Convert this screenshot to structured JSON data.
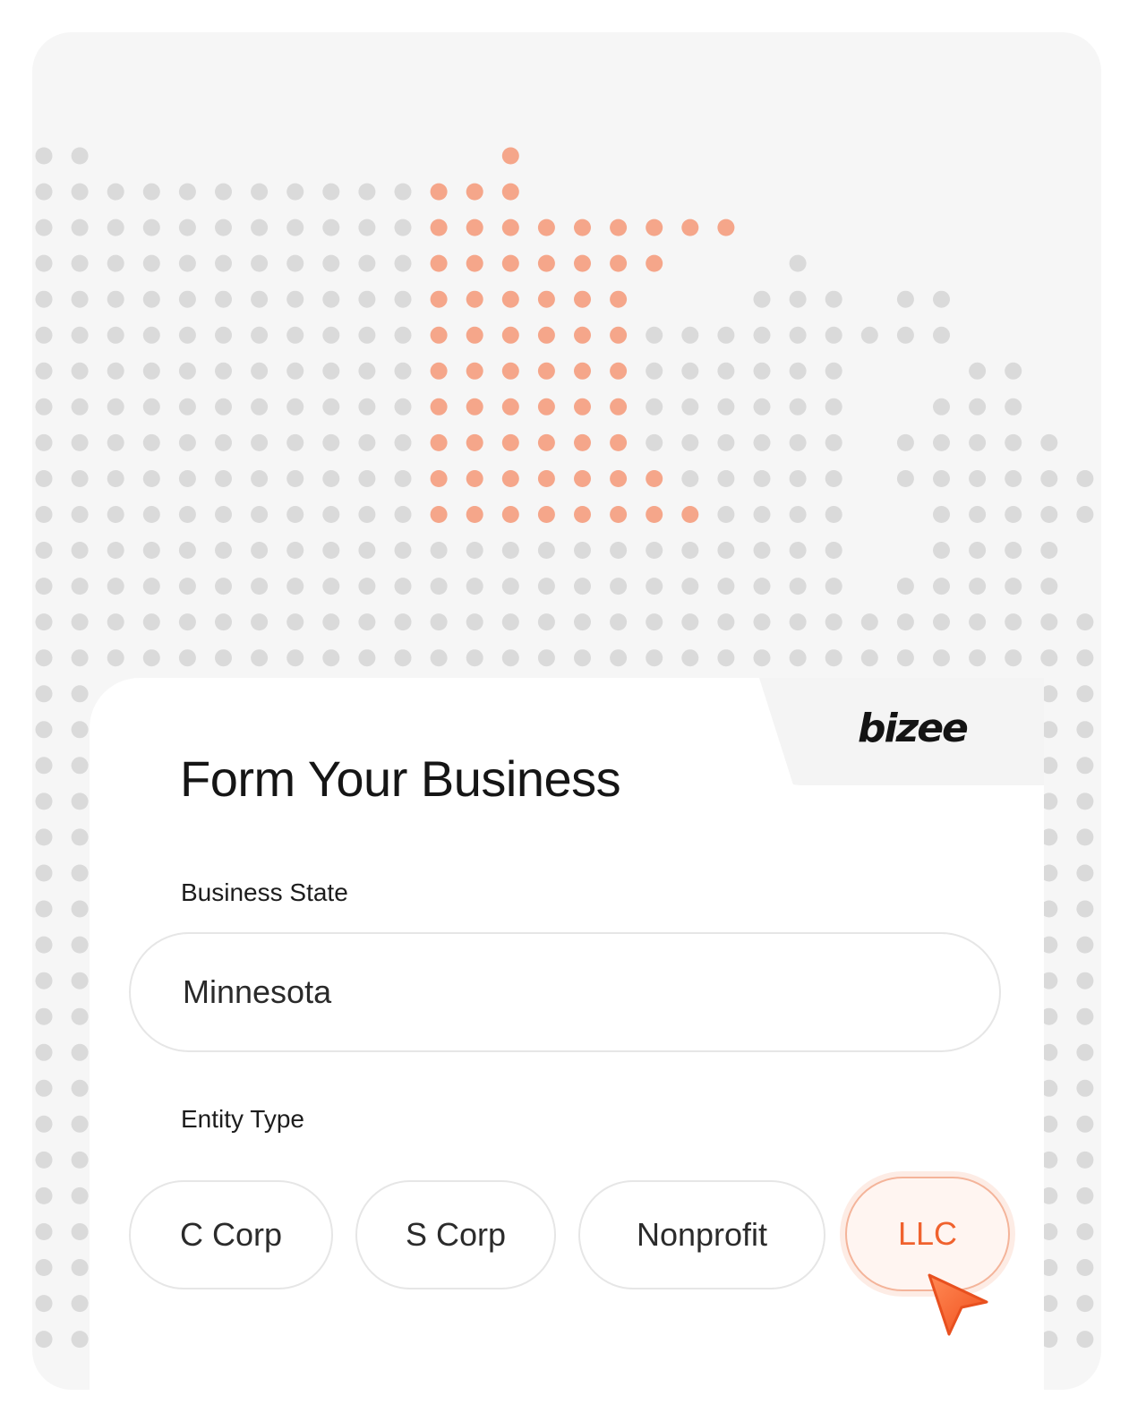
{
  "brand": {
    "logo_text": "bizee",
    "accent_color": "#f0622e",
    "dot_highlight_color": "#f5a68a",
    "dot_base_color": "#dadada"
  },
  "form": {
    "title": "Form Your Business",
    "business_state": {
      "label": "Business State",
      "value": "Minnesota"
    },
    "entity_type": {
      "label": "Entity Type",
      "options": [
        "C Corp",
        "S Corp",
        "Nonprofit",
        "LLC"
      ],
      "selected": "LLC"
    }
  },
  "map": {
    "highlighted_state": "Minnesota",
    "icon": "dot-matrix-us-map"
  },
  "cursor": {
    "icon": "pointer-arrow-icon"
  }
}
